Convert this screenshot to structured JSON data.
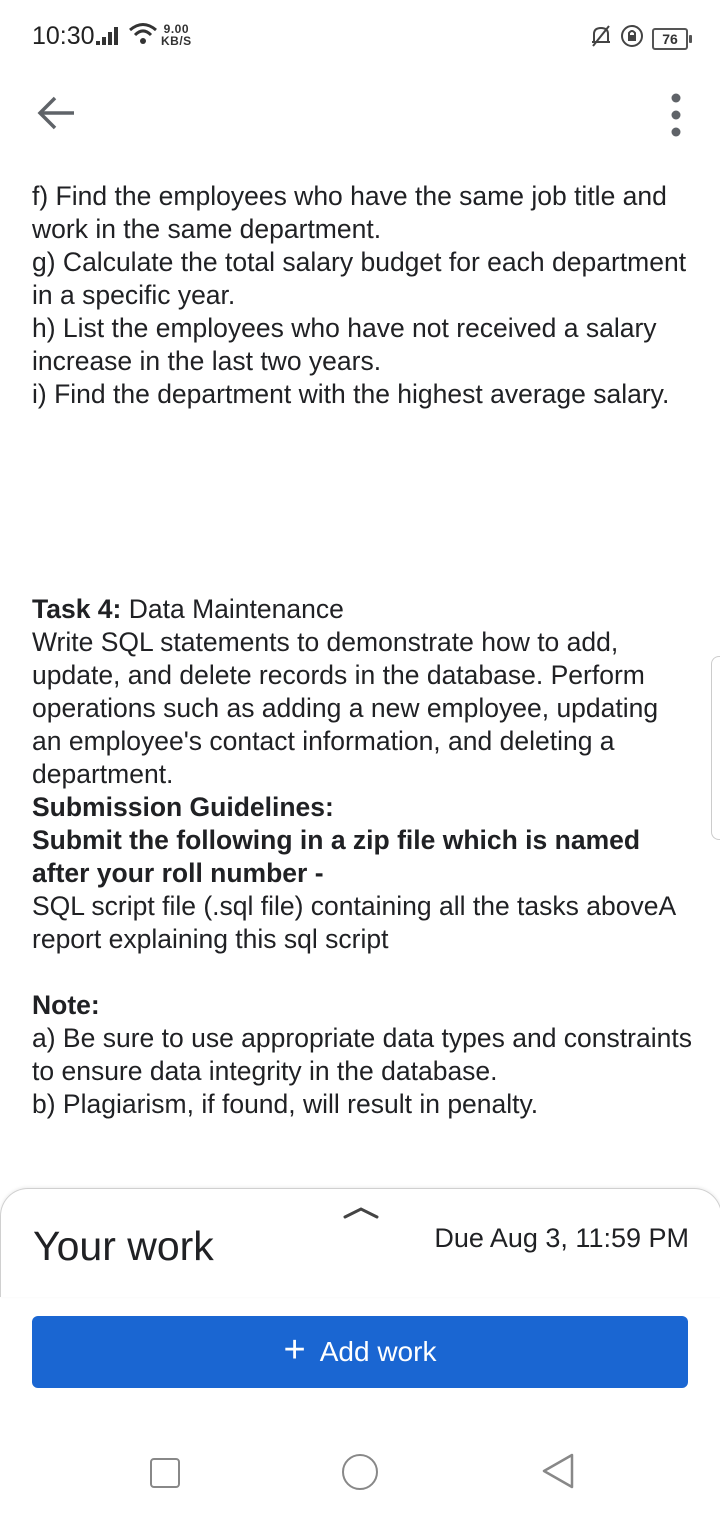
{
  "status_bar": {
    "time": "10:30",
    "speed_value": "9.00",
    "speed_unit": "KB/S",
    "battery": "76",
    "icons": [
      "signal-icon",
      "wifi-icon",
      "mute-icon",
      "lock-rotation-icon",
      "battery-icon"
    ]
  },
  "topbar": {
    "back_icon": "arrow-left-icon",
    "more_icon": "more-vertical-icon"
  },
  "content": {
    "item_f": "f) Find the employees who have the same job title and work in the same department.",
    "item_g": "g) Calculate the total salary budget for each department in a specific year.",
    "item_h": "h) List the employees who have not received a salary increase in the last two years.",
    "item_i": "i) Find the department with the highest average salary.",
    "task4_label": "Task 4:",
    "task4_title": " Data Maintenance",
    "task4_body": "Write SQL statements to demonstrate how to add, update, and delete records in the database. Perform operations such as adding a new employee, updating an employee's contact information, and deleting a department.",
    "submission_heading": "Submission Guidelines:",
    "submission_instruction": "Submit the following in a zip file which is named after your roll number -",
    "submission_items": "SQL script file (.sql file) containing all the tasks aboveA report explaining this sql script",
    "note_heading": "Note:",
    "note_a": "a) Be sure to use appropriate data types and constraints to ensure data integrity in the database.",
    "note_b": "b) Plagiarism, if found, will result in penalty."
  },
  "sheet": {
    "title": "Your work",
    "due": "Due Aug 3, 11:59 PM",
    "add_work_label": "Add work",
    "add_work_icon": "plus-icon"
  },
  "navbar": {
    "icons": [
      "recents-square-icon",
      "home-circle-icon",
      "back-triangle-icon"
    ]
  },
  "colors": {
    "accent": "#1a66d2",
    "text": "#202124"
  }
}
